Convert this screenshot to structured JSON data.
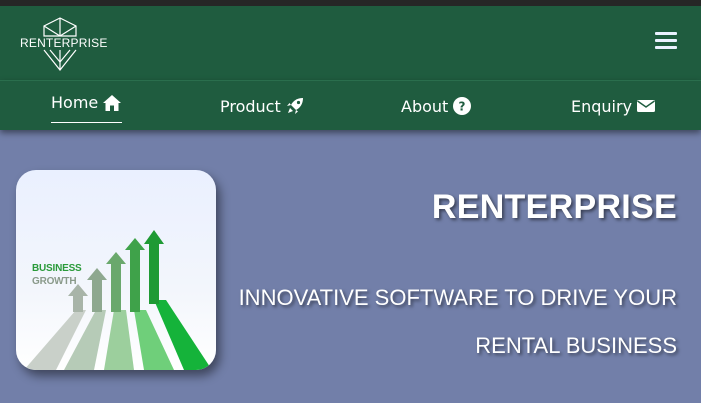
{
  "brand": {
    "logo_text": "RENTERPRISE",
    "header_color": "#1f5c3f"
  },
  "menu": {
    "icon": "hamburger-menu-icon"
  },
  "nav": {
    "items": [
      {
        "label": "Home",
        "icon": "home-icon",
        "active": true
      },
      {
        "label": "Product",
        "icon": "rocket-icon",
        "active": false
      },
      {
        "label": "About",
        "icon": "question-circle-icon",
        "active": false
      },
      {
        "label": "Enquiry",
        "icon": "envelope-icon",
        "active": false
      }
    ]
  },
  "hero": {
    "background_color": "#727fa9",
    "image": {
      "label_line_1": "BUSINESS",
      "label_line_2": "GROWTH"
    },
    "title": "RENTERPRISE",
    "subtitle_line_1": "INNOVATIVE SOFTWARE TO DRIVE YOUR",
    "subtitle_line_2": "RENTAL BUSINESS"
  }
}
